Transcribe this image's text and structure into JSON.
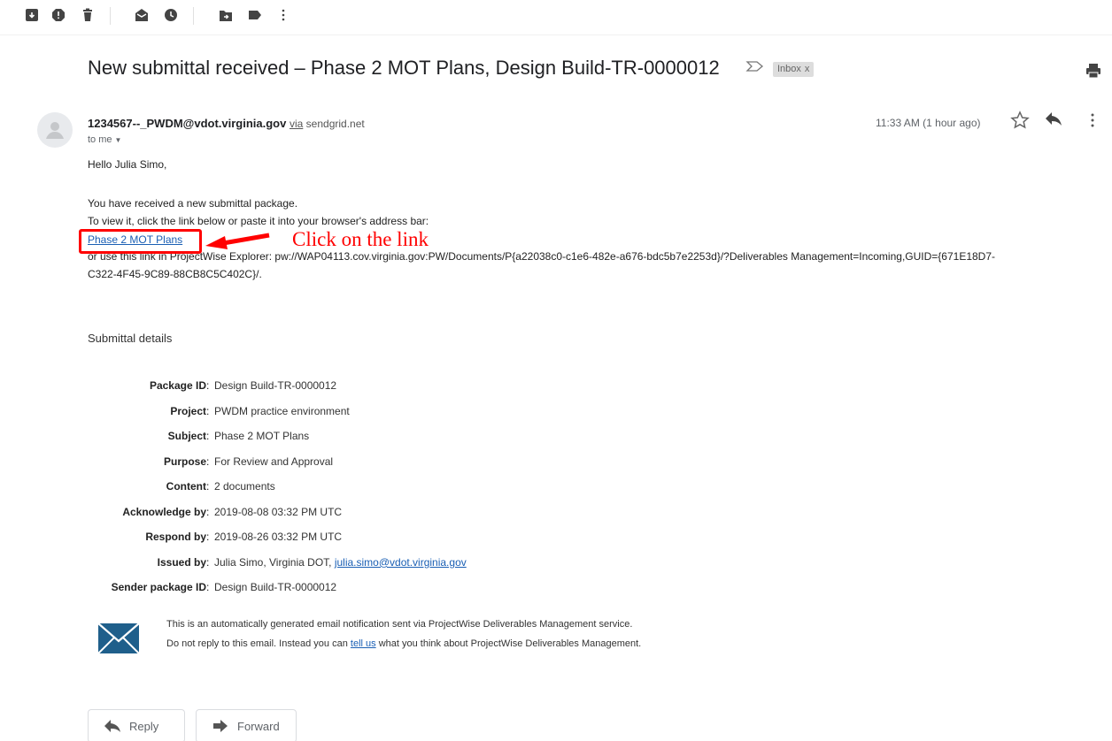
{
  "toolbar": {
    "icons": [
      "archive-icon",
      "report-spam-icon",
      "delete-icon",
      "mark-unread-icon",
      "snooze-icon",
      "move-to-icon",
      "labels-icon",
      "more-icon"
    ]
  },
  "email": {
    "subject": "New submittal received – Phase 2 MOT Plans, Design Build-TR-0000012",
    "label_chip": "Inbox",
    "label_chip_close": "x",
    "sender_address": "1234567--_PWDM@vdot.virginia.gov",
    "via_word": "via",
    "via_domain": "sendgrid.net",
    "recipient": "to me",
    "time": "11:33 AM (1 hour ago)"
  },
  "body": {
    "greeting": "Hello Julia Simo,",
    "line1": "You have received a new submittal package.",
    "line2": "To view it, click the link below or paste it into your browser's address bar:",
    "link_text": "Phase 2 MOT Plans",
    "explorer_line1": "or use this link in ProjectWise Explorer: pw://WAP04113.cov.virginia.gov:PW/Documents/P{a22038c0-c1e6-482e-a676-bdc5b7e2253d}/?Deliverables Management=Incoming,GUID={671E18D7-",
    "explorer_line2": "C322-4F45-9C89-88CB8C5C402C}/."
  },
  "annotation": {
    "text": "Click on the link",
    "color": "#ff0000"
  },
  "details": {
    "heading": "Submittal details",
    "rows": [
      {
        "key": "Package ID",
        "value": "Design Build-TR-0000012"
      },
      {
        "key": "Project",
        "value": "PWDM practice environment"
      },
      {
        "key": "Subject",
        "value": "Phase 2 MOT Plans"
      },
      {
        "key": "Purpose",
        "value": "For Review and Approval"
      },
      {
        "key": "Content",
        "value": "2 documents"
      },
      {
        "key": "Acknowledge by",
        "value": "2019-08-08 03:32 PM UTC"
      },
      {
        "key": "Respond by",
        "value": "2019-08-26 03:32 PM UTC"
      },
      {
        "key": "Issued by",
        "value": "Julia Simo, Virginia DOT, ",
        "email": "julia.simo@vdot.virginia.gov"
      },
      {
        "key": "Sender package ID",
        "value": "Design Build-TR-0000012"
      }
    ]
  },
  "footer": {
    "line1": "This is an automatically generated email notification sent via ProjectWise Deliverables Management service.",
    "line2_pre": "Do not reply to this email. Instead you can ",
    "line2_link": "tell us",
    "line2_post": " what you think about ProjectWise Deliverables Management."
  },
  "actions": {
    "reply": "Reply",
    "forward": "Forward"
  },
  "colors": {
    "link": "#1a5fb4",
    "annotation": "#ff0000",
    "icon": "#444444"
  }
}
